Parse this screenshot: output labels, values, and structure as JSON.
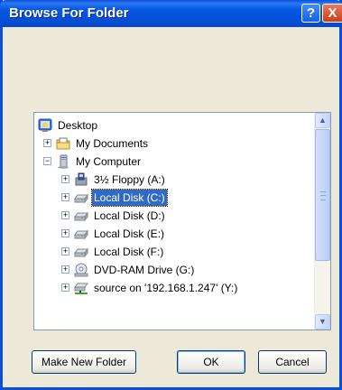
{
  "window": {
    "title": "Browse For Folder",
    "help_label": "?",
    "close_label": "X"
  },
  "tree": {
    "items": [
      {
        "label": "Desktop",
        "icon": "desktop-icon"
      },
      {
        "label": "My Documents",
        "icon": "folder-documents-icon"
      },
      {
        "label": "My Computer",
        "icon": "computer-icon"
      },
      {
        "label": "3½ Floppy (A:)",
        "icon": "floppy-icon"
      },
      {
        "label": "Local Disk (C:)",
        "icon": "hard-disk-icon",
        "selected": true
      },
      {
        "label": "Local Disk (D:)",
        "icon": "hard-disk-icon"
      },
      {
        "label": "Local Disk (E:)",
        "icon": "hard-disk-icon"
      },
      {
        "label": "Local Disk (F:)",
        "icon": "hard-disk-icon"
      },
      {
        "label": "DVD-RAM Drive (G:)",
        "icon": "dvd-drive-icon"
      },
      {
        "label": "source on '192.168.1.247' (Y:)",
        "icon": "network-drive-icon"
      }
    ],
    "expand_plus": "+",
    "expand_minus": "−"
  },
  "buttons": {
    "make_new_folder": "Make New Folder",
    "ok": "OK",
    "cancel": "Cancel"
  },
  "scrollbar": {
    "up": "▲",
    "down": "▼"
  },
  "colors": {
    "titlebar": "#0758e6",
    "selection": "#316ac5",
    "dialog_bg": "#ece9d8"
  }
}
